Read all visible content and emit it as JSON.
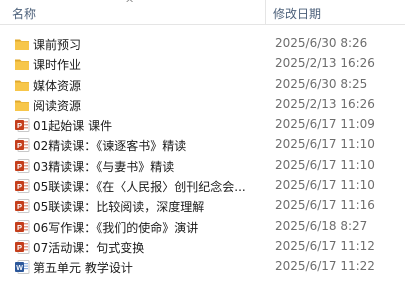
{
  "header": {
    "name_label": "名称",
    "date_label": "修改日期",
    "sort_indicator": "^"
  },
  "files": [
    {
      "name": "课前预习",
      "date": "2025/6/30 8:26",
      "type": "folder"
    },
    {
      "name": "课时作业",
      "date": "2025/2/13 16:26",
      "type": "folder"
    },
    {
      "name": "媒体资源",
      "date": "2025/6/30 8:25",
      "type": "folder"
    },
    {
      "name": "阅读资源",
      "date": "2025/2/13 16:26",
      "type": "folder"
    },
    {
      "name": "01起始课 课件",
      "date": "2025/6/17 11:09",
      "type": "ppt"
    },
    {
      "name": "02精读课：《谏逐客书》精读",
      "date": "2025/6/17 11:10",
      "type": "ppt"
    },
    {
      "name": "03精读课：《与妻书》精读",
      "date": "2025/6/17 11:10",
      "type": "ppt"
    },
    {
      "name": "05联读课：《在〈人民报〉创刊纪念会...",
      "date": "2025/6/17 11:10",
      "type": "ppt"
    },
    {
      "name": "05联读课：比较阅读，深度理解",
      "date": "2025/6/17 11:16",
      "type": "ppt"
    },
    {
      "name": "06写作课：《我们的使命》演讲",
      "date": "2025/6/18 8:27",
      "type": "ppt"
    },
    {
      "name": "07活动课：句式变换",
      "date": "2025/6/17 11:12",
      "type": "ppt"
    },
    {
      "name": "第五单元 教学设计",
      "date": "2025/6/17 11:22",
      "type": "word"
    }
  ],
  "colors": {
    "folder": "#f7c64a",
    "ppt": "#c43e1c",
    "word": "#2b579a",
    "header_text": "#4c607a"
  }
}
